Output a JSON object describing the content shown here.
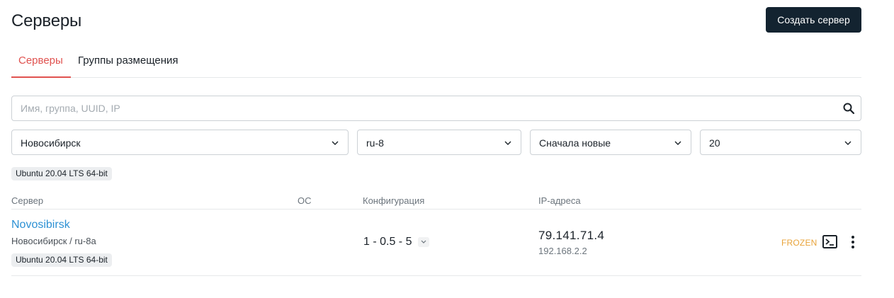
{
  "header": {
    "title": "Серверы",
    "create_button": "Создать сервер"
  },
  "tabs": [
    {
      "label": "Серверы",
      "active": true
    },
    {
      "label": "Группы размещения",
      "active": false
    }
  ],
  "search": {
    "placeholder": "Имя, группа, UUID, IP",
    "value": "",
    "icon": "search-icon"
  },
  "filters": {
    "city": "Новосибирск",
    "region": "ru-8",
    "sort": "Сначала новые",
    "per_page": "20",
    "active_chip": "Ubuntu 20.04 LTS 64-bit"
  },
  "table": {
    "columns": [
      "Сервер",
      "ОС",
      "Конфигурация",
      "IP-адреса"
    ],
    "rows": [
      {
        "name": "Novosibirsk",
        "location": "Новосибирск / ru-8a",
        "os_chip": "Ubuntu 20.04 LTS 64-bit",
        "config": "1 - 0.5 - 5",
        "ip_public": "79.141.71.4",
        "ip_private": "192.168.2.2",
        "status": "FROZEN",
        "actions": [
          "console-icon",
          "more-vertical-icon"
        ]
      }
    ]
  },
  "colors": {
    "accent": "#e0524f",
    "primary_button": "#132330",
    "link": "#2d91d4",
    "status_frozen": "#e8a33a"
  }
}
